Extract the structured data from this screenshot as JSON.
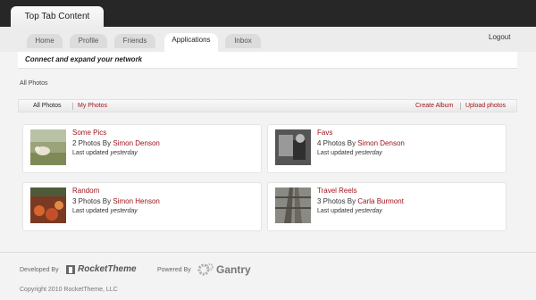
{
  "header": {
    "top_tab": "Top Tab Content"
  },
  "nav": {
    "tabs": [
      {
        "label": "Home"
      },
      {
        "label": "Profile"
      },
      {
        "label": "Friends"
      },
      {
        "label": "Applications"
      },
      {
        "label": "Inbox"
      }
    ],
    "active_tab": "Applications",
    "logout": "Logout"
  },
  "subheader": {
    "text": "Connect and expand your network"
  },
  "page": {
    "title": "All Photos"
  },
  "filters": {
    "all_photos": "All Photos",
    "my_photos": "My Photos",
    "create_album": "Create Album",
    "upload_photos": "Upload photos"
  },
  "albums": [
    {
      "title": "Some Pics",
      "count": "2 Photos By",
      "owner": "Simon Denson",
      "updated_label": "Last updated",
      "updated_when": "yesterday"
    },
    {
      "title": "Favs",
      "count": "4 Photos By",
      "owner": "Simon Denson",
      "updated_label": "Last updated",
      "updated_when": "yesterday"
    },
    {
      "title": "Random",
      "count": "3 Photos By",
      "owner": "Simon Henson",
      "updated_label": "Last updated",
      "updated_when": "yesterday"
    },
    {
      "title": "Travel Reels",
      "count": "3 Photos By",
      "owner": "Carla Burmont",
      "updated_label": "Last updated",
      "updated_when": "yesterday"
    }
  ],
  "footer": {
    "developed_by": "Developed By",
    "rockettheme": "RocketTheme",
    "powered_by": "Powered By",
    "gantry": "Gantry",
    "copyright": "Copyright 2010 RocketTheme, LLC"
  },
  "colors": {
    "accent": "#a0131b",
    "topbar": "#272727",
    "background": "#f3f3f3"
  }
}
